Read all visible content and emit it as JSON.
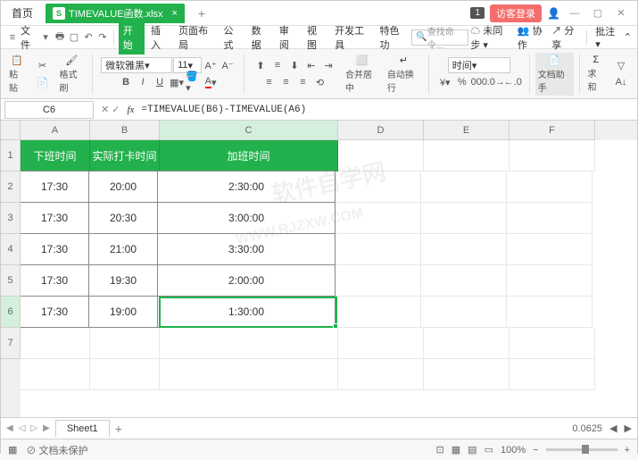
{
  "titlebar": {
    "home_tab": "首页",
    "file_tab": "TIMEVALUE函数.xlsx",
    "badge": "1",
    "login": "访客登录"
  },
  "menubar": {
    "file": "文件",
    "tabs": [
      "开始",
      "插入",
      "页面布局",
      "公式",
      "数据",
      "审阅",
      "视图",
      "开发工具",
      "特色功"
    ],
    "search_placeholder": "查找命令...",
    "unsync": "未同步",
    "collab": "协作",
    "share": "分享",
    "batch": "批注"
  },
  "toolbar": {
    "paste": "粘贴",
    "format_painter": "格式刷",
    "font_name": "微软雅黑",
    "font_size": "11",
    "merge": "合并居中",
    "wrap": "自动换行",
    "numfmt": "时间",
    "doc_helper": "文档助手",
    "sum": "求和"
  },
  "formula": {
    "cell_ref": "C6",
    "value": "=TIMEVALUE(B6)-TIMEVALUE(A6)"
  },
  "columns": [
    "A",
    "B",
    "C",
    "D",
    "E",
    "F"
  ],
  "rows": [
    "1",
    "2",
    "3",
    "4",
    "5",
    "6",
    "7"
  ],
  "headers": {
    "A": "下班时间",
    "B": "实际打卡时间",
    "C": "加班时间"
  },
  "data": [
    {
      "A": "17:30",
      "B": "20:00",
      "C": "2:30:00"
    },
    {
      "A": "17:30",
      "B": "20:30",
      "C": "3:00:00"
    },
    {
      "A": "17:30",
      "B": "21:00",
      "C": "3:30:00"
    },
    {
      "A": "17:30",
      "B": "19:30",
      "C": "2:00:00"
    },
    {
      "A": "17:30",
      "B": "19:00",
      "C": "1:30:00"
    }
  ],
  "sheet_tabs": {
    "active": "Sheet1",
    "value": "0.0625"
  },
  "statusbar": {
    "protect": "文档未保护",
    "zoom": "100%"
  },
  "watermark": {
    "line1": "软件自学网",
    "line2": "WWW.RJZXW.COM"
  }
}
